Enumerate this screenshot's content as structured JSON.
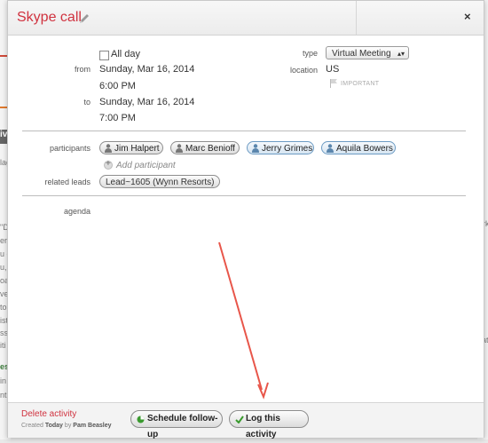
{
  "modal": {
    "title": "Skype call",
    "close_glyph": "×"
  },
  "form": {
    "all_day_label": "All day",
    "from_label": "from",
    "from_date": "Sunday, Mar 16, 2014",
    "from_time": "6:00 PM",
    "to_label": "to",
    "to_date": "Sunday, Mar 16, 2014",
    "to_time": "7:00 PM",
    "type_label": "type",
    "type_value": "Virtual Meeting",
    "location_label": "location",
    "location_value": "US",
    "important_label": "IMPORTANT",
    "participants_label": "participants",
    "participants": [
      {
        "name": "Jim Halpert",
        "style": "gray"
      },
      {
        "name": "Marc Benioff",
        "style": "gray"
      },
      {
        "name": "Jerry Grimes",
        "style": "blue"
      },
      {
        "name": "Aquila Bowers",
        "style": "blue"
      }
    ],
    "add_participant_label": "Add participant",
    "related_leads_label": "related leads",
    "related_lead": "Lead~1605 (Wynn Resorts)",
    "agenda_label": "agenda"
  },
  "footer": {
    "delete_label": "Delete activity",
    "created_prefix": "Created",
    "created_when": "Today",
    "created_by_word": "by",
    "created_by": "Pam Beasley",
    "schedule_followup_label": "Schedule follow-up",
    "log_activity_label": "Log this activity"
  },
  "background": {
    "fragments": [
      "iv",
      "lag",
      "\"D",
      "ery",
      "u c",
      "u, c",
      "oa",
      "ve",
      "to",
      "ist",
      "ss",
      "iti",
      "es",
      "in",
      "ntl",
      "ati",
      "rk"
    ]
  },
  "colors": {
    "title": "#d0323f",
    "annotation_arrow": "#e8564a",
    "check_green": "#3a9a2f"
  },
  "icons": {
    "edit": "pencil-icon",
    "close": "close-icon",
    "flag": "flag-icon",
    "person": "person-icon",
    "add": "add-icon",
    "schedule": "green-dot-icon",
    "log": "checkmark-icon"
  }
}
